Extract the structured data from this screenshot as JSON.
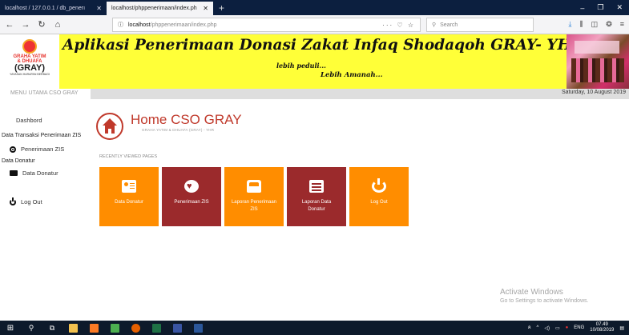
{
  "browser": {
    "tabs": [
      {
        "label": "localhost / 127.0.0.1 / db_penerı",
        "close": "✕"
      },
      {
        "label": "localhost/phppenerimaan/index.ph",
        "close": "✕"
      }
    ],
    "new_tab": "+",
    "window_controls": [
      "–",
      "❐",
      "✕"
    ],
    "url_prefix": "localhost",
    "url_tail": "/phppenerimaan/index.php",
    "page_actions": "··· ♡ ☆",
    "search_placeholder": "Search"
  },
  "banner": {
    "logo_line1": "GRAHA YATIM",
    "logo_line1b": "& DHUAFA",
    "logo_line2": "(GRAY)",
    "logo_line3": "YAYASAN HARAPAN BERBAGI",
    "title": "Aplikasi Penerimaan Donasi Zakat Infaq Shodaqoh GRAY- YHR",
    "tagline1": "lebih peduli...",
    "tagline2": "Lebih Amanah..."
  },
  "info": {
    "date": "Saturday, 10 August 2019"
  },
  "sidebar": {
    "menu_title": "MENU UTAMA CSO GRAY",
    "dashboard": "Dashbord",
    "section1": "Data Transaksi Penerimaan ZIS",
    "penerimaan": "Penerimaan ZIS",
    "section2": "Data Donatur",
    "data_donatur": "Data Donatur",
    "logout": "Log Out"
  },
  "main": {
    "title": "Home CSO GRAY",
    "subtitle": "GRAHA YATIM & DHUAFA (GRAY) - YHR",
    "recent_label": "RECENTLY VIEWED PAGES",
    "tiles": [
      {
        "label": "Data Donatur",
        "color": "#ff8d00",
        "icon": "id-card-icon"
      },
      {
        "label": "Penerimaan ZIS",
        "color": "#9b2a2c",
        "icon": "heart-icon"
      },
      {
        "label": "Laporan Penerimaan ZIS",
        "color": "#ff8d00",
        "icon": "inbox-icon"
      },
      {
        "label": "Laporan Data Donatur",
        "color": "#9b2a2c",
        "icon": "list-icon"
      },
      {
        "label": "Log Out",
        "color": "#ff8d00",
        "icon": "power-icon"
      }
    ]
  },
  "watermark": {
    "line1": "Activate Windows",
    "line2": "Go to Settings to activate Windows."
  },
  "taskbar": {
    "lang": "ENG",
    "time": "07.49",
    "date": "10/08/2019"
  }
}
